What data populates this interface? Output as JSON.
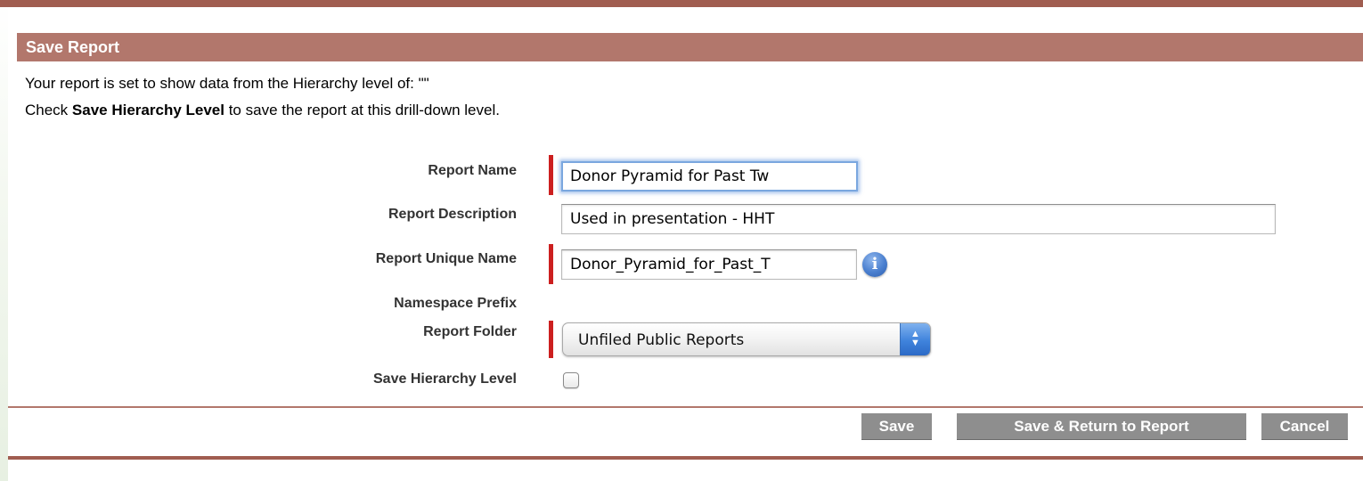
{
  "header": {
    "title": "Save Report"
  },
  "intro": {
    "line1": "Your report is set to show data from the Hierarchy level of: \"\"",
    "line2_prefix": "Check ",
    "line2_bold": "Save Hierarchy Level",
    "line2_suffix": " to save the report at this drill-down level."
  },
  "form": {
    "report_name": {
      "label": "Report Name",
      "value": "Donor Pyramid for Past Tw",
      "required": true,
      "focused": true
    },
    "report_description": {
      "label": "Report Description",
      "value": "Used in presentation - HHT",
      "required": false
    },
    "report_unique_name": {
      "label": "Report Unique Name",
      "value": "Donor_Pyramid_for_Past_T",
      "required": true,
      "info_icon": "info-icon",
      "info_glyph": "i"
    },
    "namespace_prefix": {
      "label": "Namespace Prefix"
    },
    "report_folder": {
      "label": "Report Folder",
      "value": "Unfiled Public Reports",
      "required": true,
      "arrow_up": "▲",
      "arrow_down": "▼"
    },
    "save_hierarchy_level": {
      "label": "Save Hierarchy Level",
      "checked": false
    }
  },
  "buttons": {
    "save": "Save",
    "save_return": "Save & Return to Report",
    "cancel": "Cancel"
  },
  "colors": {
    "header_bar": "#b2776c",
    "rule": "#a05d50",
    "required_marker": "#cc1f1f",
    "button": "#8e8e8e",
    "focus_ring": "#7aa7df"
  }
}
